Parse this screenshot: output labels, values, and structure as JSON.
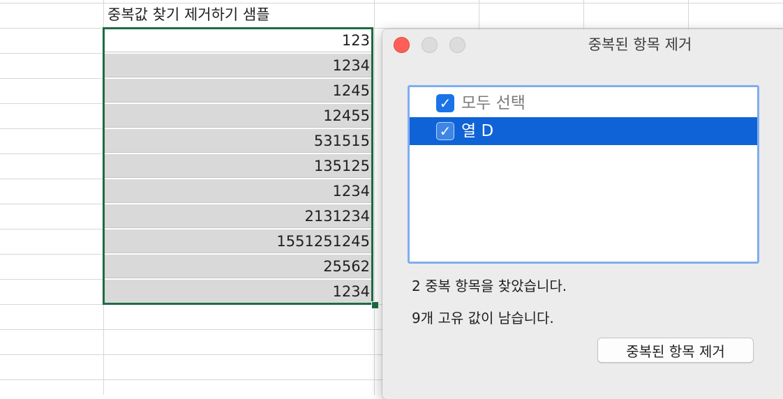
{
  "sheet": {
    "header_label": "중복값 찾기 제거하기 샘플",
    "values": [
      "123",
      "1234",
      "1245",
      "12455",
      "531515",
      "135125",
      "1234",
      "2131234",
      "1551251245",
      "25562",
      "1234"
    ]
  },
  "dialog": {
    "title": "중복된 항목 제거",
    "list_items": [
      {
        "label": "모두 선택",
        "checked": true,
        "selected": false
      },
      {
        "label": "열 D",
        "checked": true,
        "selected": true
      }
    ],
    "message_duplicates": "2 중복 항목을 찾았습니다.",
    "message_unique": "9개 고유 값이 남습니다.",
    "remove_button_label": "중복된 항목 제거"
  },
  "colors": {
    "selection_border": "#1e6b43",
    "list_highlight": "#0f63d6",
    "checkbox_blue": "#1a73e8",
    "close_red": "#fe5f57"
  },
  "icons": {
    "checkbox": "checkmark-icon",
    "close": "close-icon",
    "minimize": "minimize-icon",
    "zoom": "zoom-icon"
  }
}
